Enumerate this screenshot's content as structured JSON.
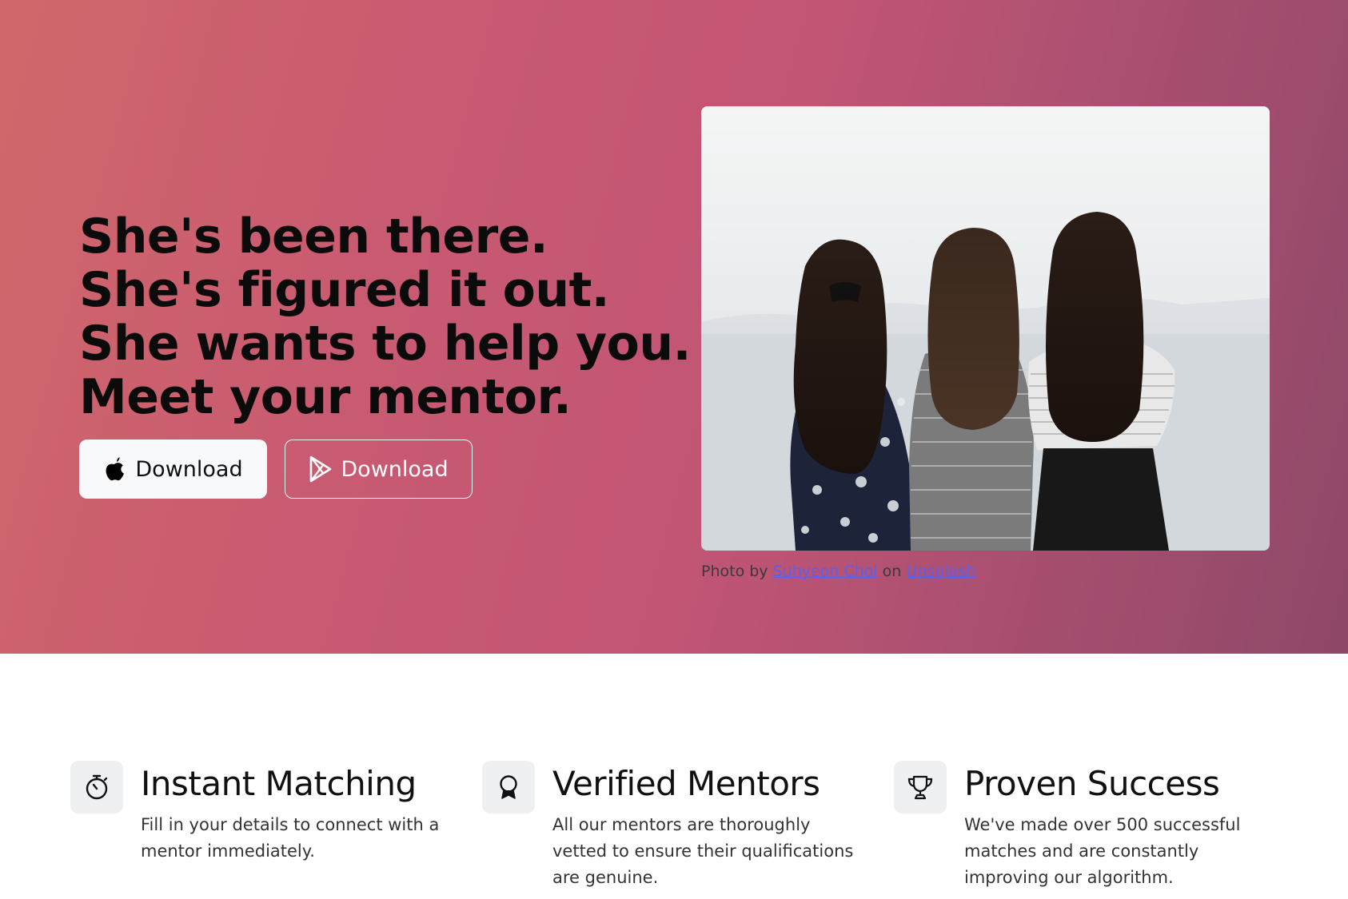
{
  "hero": {
    "headline": [
      "She's been there.",
      "She's figured it out.",
      "She wants to help you.",
      "Meet your mentor."
    ],
    "buttons": {
      "apple_label": "Download",
      "play_label": "Download"
    },
    "photo": {
      "alt": "Three women with long hair facing the sea",
      "credit_prefix": "Photo by",
      "author": "Suhyeon Choi",
      "credit_mid": "on",
      "source": "Unsplash"
    }
  },
  "features": [
    {
      "icon": "stopwatch-icon",
      "title": "Instant Matching",
      "description": "Fill in your details to connect with a mentor immediately."
    },
    {
      "icon": "award-icon",
      "title": "Verified Mentors",
      "description": "All our mentors are thoroughly vetted to ensure their qualifications are genuine."
    },
    {
      "icon": "trophy-icon",
      "title": "Proven Success",
      "description": "We've made over 500 successful matches and are constantly improving our algorithm."
    }
  ],
  "colors": {
    "hero_gradient_start": "#d0686a",
    "hero_gradient_mid": "#c25574",
    "hero_gradient_end": "#8f4868",
    "link": "#5a5ff0"
  }
}
